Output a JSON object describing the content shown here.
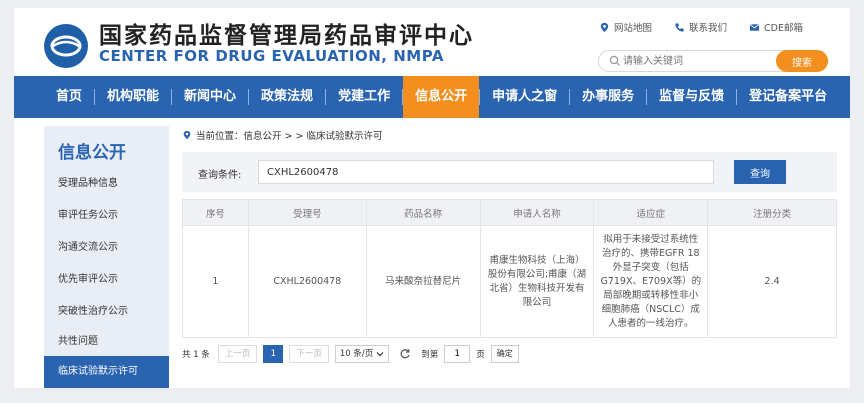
{
  "header": {
    "title_cn": "国家药品监督管理局药品审评中心",
    "title_en": "CENTER FOR DRUG EVALUATION, NMPA",
    "links": [
      {
        "icon": "location-pin-icon",
        "label": "网站地图"
      },
      {
        "icon": "phone-icon",
        "label": "联系我们"
      },
      {
        "icon": "mail-icon",
        "label": "CDE邮箱"
      }
    ],
    "search_placeholder": "请输入关键词",
    "search_button": "搜索"
  },
  "nav": {
    "items": [
      "首页",
      "机构职能",
      "新闻中心",
      "政策法规",
      "党建工作",
      "信息公开",
      "申请人之窗",
      "办事服务",
      "监督与反馈",
      "登记备案平台"
    ],
    "active": "信息公开"
  },
  "sidebar": {
    "title": "信息公开",
    "items": [
      "受理品种信息",
      "审评任务公示",
      "沟通交流公示",
      "优先审评公示",
      "突破性治疗公示",
      "共性问题",
      "临床试验默示许可"
    ],
    "active": "临床试验默示许可"
  },
  "breadcrumb": {
    "prefix": "当前位置：",
    "path": "信息公开 > > 临床试验默示许可"
  },
  "query": {
    "label": "查询条件:",
    "value": "CXHL2600478",
    "button": "查询"
  },
  "table": {
    "headers": [
      "序号",
      "受理号",
      "药品名称",
      "申请人名称",
      "适应症",
      "注册分类"
    ],
    "rows": [
      [
        "1",
        "CXHL2600478",
        "马来酸奈拉替尼片",
        "甫康生物科技（上海）股份有限公司;甫康（湖北省）生物科技开发有限公司",
        "拟用于未接受过系统性治疗的、携带EGFR 18外显子突变（包括G719X、E709X等）的局部晚期或转移性非小细胞肺癌（NSCLC）成人患者的一线治疗。",
        "2.4"
      ]
    ]
  },
  "pager": {
    "total": "共 1 条",
    "prev": "上一页",
    "current": "1",
    "next": "下一页",
    "page_size": "10 条/页",
    "goto_label": "到第",
    "goto_value": "1",
    "page_unit": "页",
    "confirm": "确定"
  },
  "colors": {
    "primary": "#2a64b0",
    "accent": "#f28f1e",
    "sidebar_bg": "#e9eef6"
  }
}
